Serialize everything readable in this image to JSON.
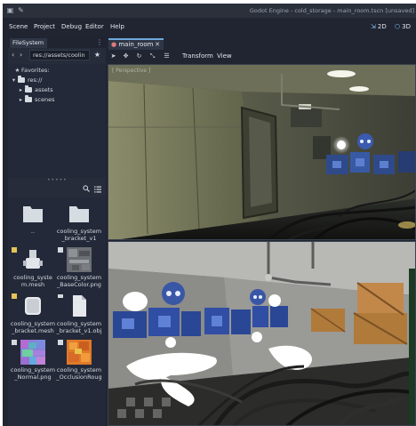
{
  "window": {
    "title": "Godot Engine - cold_storage - main_room.tscn [unsaved]"
  },
  "menu": {
    "items": [
      "Scene",
      "Project",
      "Debug",
      "Editor",
      "Help"
    ],
    "mode_2d": "2D",
    "mode_3d": "3D"
  },
  "dock": {
    "tab_label": "FileSystem",
    "path": "res://assets/coolin",
    "tree": {
      "favorites": "Favorites:",
      "root": "res://",
      "folders": [
        "assets",
        "scenes"
      ]
    },
    "files": [
      {
        "name": "..",
        "kind": "folder"
      },
      {
        "name": "cooling_system_bracket_v1",
        "kind": "folder"
      },
      {
        "name": "cooling_system.mesh",
        "kind": "mesh"
      },
      {
        "name": "cooling_system_BaseColor.png",
        "kind": "texture-gray"
      },
      {
        "name": "cooling_system_bracket.mesh",
        "kind": "mesh-white"
      },
      {
        "name": "cooling_system_bracket_v1.obj",
        "kind": "document"
      },
      {
        "name": "cooling_system_Normal.png",
        "kind": "texture-normal"
      },
      {
        "name": "cooling_system_OcclusionRoughness.png",
        "kind": "texture-orange"
      }
    ]
  },
  "editor": {
    "scene_tab": "main_room",
    "toolbar": {
      "transform": "Transform",
      "view": "View"
    },
    "viewport_label": "[ Perspective ]"
  },
  "colors": {
    "panel": "#202531",
    "dock": "#262c3a",
    "accent": "#6fa8dc"
  }
}
